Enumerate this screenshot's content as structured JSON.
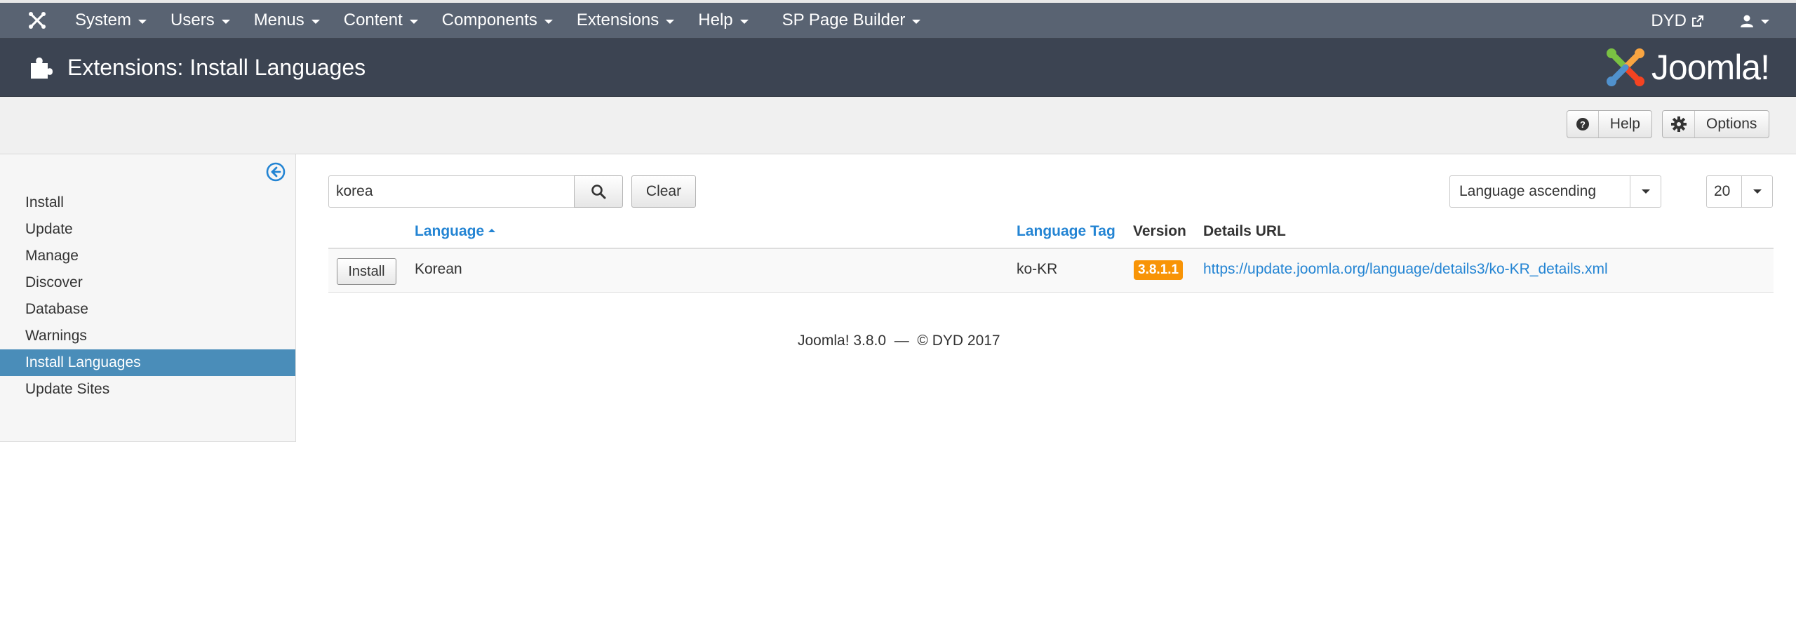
{
  "topnav": {
    "logo_icon": "joomla-icon",
    "menu": [
      "System",
      "Users",
      "Menus",
      "Content",
      "Components",
      "Extensions",
      "Help",
      "SP Page Builder"
    ],
    "site_name": "DYD",
    "site_icon": "external-link-icon",
    "user_icon": "user-icon"
  },
  "header": {
    "icon": "puzzle-icon",
    "title": "Extensions: Install Languages",
    "brand": "Joomla!"
  },
  "toolbar": {
    "help_label": "Help",
    "options_label": "Options"
  },
  "sidebar": {
    "items": [
      "Install",
      "Update",
      "Manage",
      "Discover",
      "Database",
      "Warnings",
      "Install Languages",
      "Update Sites"
    ],
    "active": "Install Languages"
  },
  "filters": {
    "search_value": "korea",
    "clear_label": "Clear",
    "ordering": "Language ascending",
    "limit": "20"
  },
  "table": {
    "headers": {
      "language": "Language",
      "tag": "Language Tag",
      "version": "Version",
      "details": "Details URL"
    },
    "rows": [
      {
        "action": "Install",
        "language": "Korean",
        "tag": "ko-KR",
        "version": "3.8.1.1",
        "url": "https://update.joomla.org/language/details3/ko-KR_details.xml"
      }
    ]
  },
  "footer": "Joomla! 3.8.0  —  © DYD 2017",
  "colors": {
    "topnav": "#596372",
    "header": "#3c4452",
    "link": "#2384d3",
    "active_sidebar": "#4a8db9",
    "version_badge": "#f89406"
  }
}
